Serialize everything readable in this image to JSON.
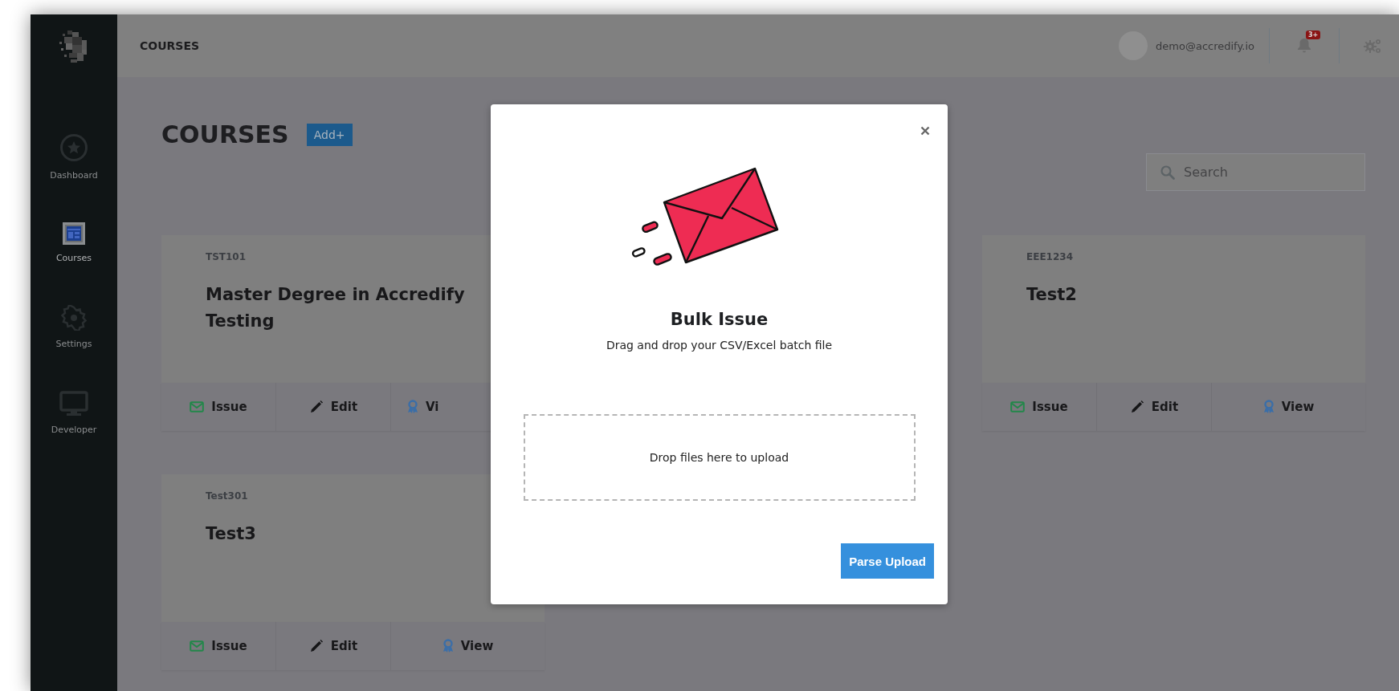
{
  "sidebar": {
    "items": [
      {
        "kind": "dashboard",
        "label": "Dashboard",
        "selected": false
      },
      {
        "kind": "courses",
        "label": "Courses",
        "selected": true
      },
      {
        "kind": "settings",
        "label": "Settings",
        "selected": false
      },
      {
        "kind": "developer",
        "label": "Developer",
        "selected": false
      }
    ]
  },
  "header": {
    "title": "COURSES",
    "user": "demo@accredify.io",
    "notification_badge": "3+"
  },
  "page": {
    "heading": "COURSES",
    "add_button": "Add+",
    "search": {
      "placeholder": "Search"
    }
  },
  "courses": [
    {
      "code": "TST101",
      "title": "Master Degree in Accredify Testing",
      "actions": [
        {
          "kind": "issue",
          "label": "Issue"
        },
        {
          "kind": "edit",
          "label": "Edit"
        },
        {
          "kind": "view",
          "label": "Vi"
        }
      ]
    },
    {
      "code": "EEE1234",
      "title": "Test2",
      "actions": [
        {
          "kind": "issue",
          "label": "Issue"
        },
        {
          "kind": "edit",
          "label": "Edit"
        },
        {
          "kind": "view",
          "label": "View"
        }
      ]
    },
    {
      "code": "Test301",
      "title": "Test3",
      "actions": [
        {
          "kind": "issue",
          "label": "Issue"
        },
        {
          "kind": "edit",
          "label": "Edit"
        },
        {
          "kind": "view",
          "label": "View"
        }
      ]
    }
  ],
  "modal": {
    "title": "Bulk Issue",
    "subtitle": "Drag and drop your CSV/Excel batch file",
    "dropzone": "Drop files here to upload",
    "button": "Parse Upload"
  }
}
